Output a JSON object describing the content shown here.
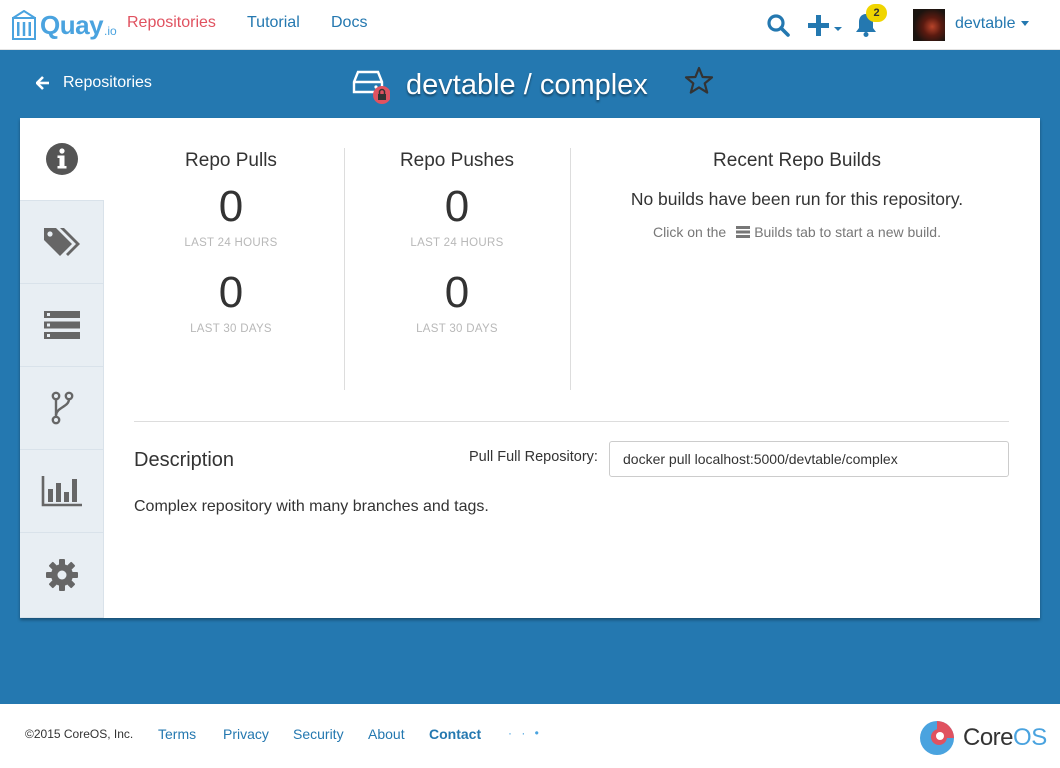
{
  "nav": {
    "logo_text": "Quay",
    "logo_sub": ".io",
    "links": [
      "Repositories",
      "Tutorial",
      "Docs"
    ],
    "notification_count": "2",
    "username": "devtable"
  },
  "header": {
    "back_label": "Repositories",
    "repo_name": "devtable / complex"
  },
  "stats": {
    "pulls": {
      "title": "Repo Pulls",
      "day_value": "0",
      "day_label": "LAST 24 HOURS",
      "month_value": "0",
      "month_label": "LAST 30 DAYS"
    },
    "pushes": {
      "title": "Repo Pushes",
      "day_value": "0",
      "day_label": "LAST 24 HOURS",
      "month_value": "0",
      "month_label": "LAST 30 DAYS"
    }
  },
  "builds": {
    "title": "Recent Repo Builds",
    "empty_message": "No builds have been run for this repository.",
    "hint_prefix": "Click on the",
    "hint_suffix": "Builds tab to start a new build."
  },
  "description": {
    "title": "Description",
    "text": "Complex repository with many branches and tags."
  },
  "pull": {
    "label": "Pull Full Repository:",
    "command": "docker pull localhost:5000/devtable/complex"
  },
  "footer": {
    "copyright": "©2015 CoreOS, Inc.",
    "links": [
      "Terms",
      "Privacy",
      "Security",
      "About",
      "Contact"
    ],
    "dots": "· · •",
    "brand_core": "Core",
    "brand_os": "OS"
  },
  "colors": {
    "primary_blue": "#2478b0",
    "active_nav": "#e05260",
    "badge_yellow": "#f0d500",
    "tab_bg": "#e8eef3"
  },
  "tabs": [
    {
      "icon": "info-icon"
    },
    {
      "icon": "tags-icon"
    },
    {
      "icon": "tag-list-icon"
    },
    {
      "icon": "branch-icon"
    },
    {
      "icon": "usage-chart-icon"
    },
    {
      "icon": "settings-gear-icon"
    }
  ]
}
